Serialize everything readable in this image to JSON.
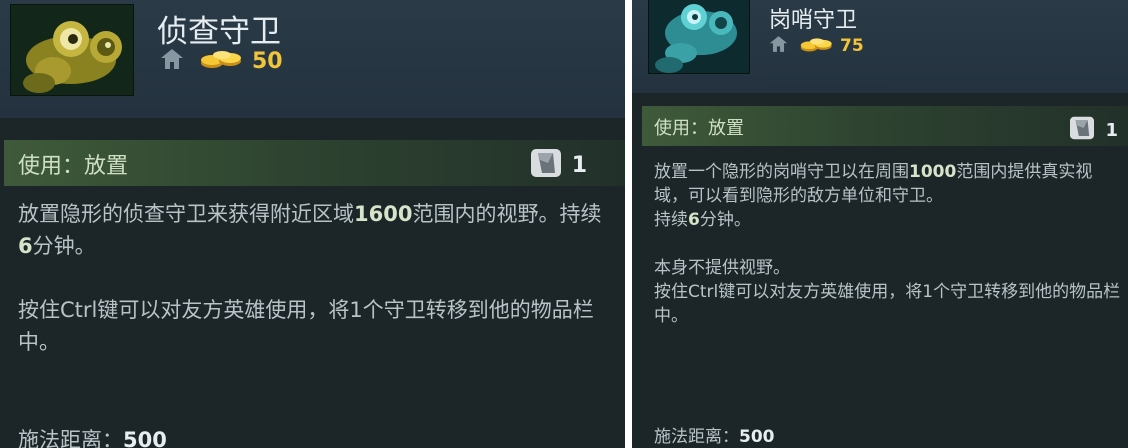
{
  "left": {
    "name": "侦查守卫",
    "cost": "50",
    "ability_label": "使用：放置",
    "charges": "1",
    "desc_line1_a": "放置隐形的侦查守卫来获得附近区域",
    "desc_line1_hl": "1600",
    "desc_line1_b": "范围内的视野。持续",
    "desc_line1_hl2": "6",
    "desc_line1_c": "分钟。",
    "desc_para2": "按住Ctrl键可以对友方英雄使用，将1个守卫转移到他的物品栏中。",
    "range_label": "施法距离：",
    "range_value": "500"
  },
  "right": {
    "name": "岗哨守卫",
    "cost": "75",
    "ability_label": "使用：放置",
    "charges": "1",
    "desc_a": "放置一个隐形的岗哨守卫以在周围",
    "desc_hl": "1000",
    "desc_b": "范围内提供真实视域，可以看到隐形的敌方单位和守卫。",
    "desc_c": "持续",
    "desc_hl2": "6",
    "desc_d": "分钟。",
    "desc_para2_line1": "本身不提供视野。",
    "desc_para2_line2": "按住Ctrl键可以对友方英雄使用，将1个守卫转移到他的物品栏中。",
    "range_label": "施法距离：",
    "range_value": "500"
  },
  "colors": {
    "gold": "#f2c43a",
    "panel_bg": "#1c2629",
    "ability_bar": "#3f5a3a",
    "text": "#b7c3c7"
  },
  "icons": [
    "observer-ward-portrait",
    "sentry-ward-portrait",
    "home-shop-icon",
    "gold-coins-icon",
    "charges-icon"
  ]
}
